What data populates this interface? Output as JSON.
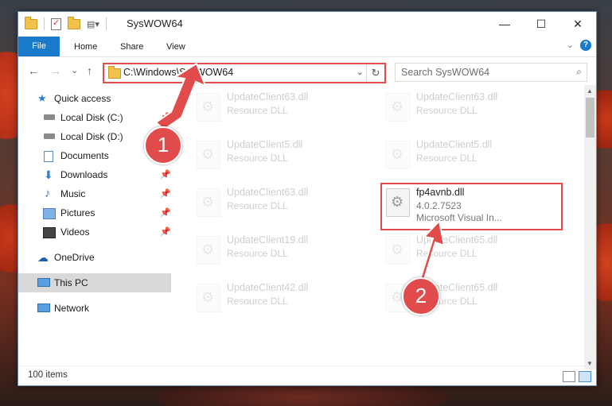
{
  "window": {
    "title": "SysWOW64",
    "minimize_glyph": "—",
    "maximize_glyph": "☐",
    "close_glyph": "✕"
  },
  "ribbon": {
    "tabs": [
      "File",
      "Home",
      "Share",
      "View"
    ],
    "help_glyph": "?",
    "expand_glyph": "⌄"
  },
  "nav": {
    "back_glyph": "←",
    "forward_glyph": "→",
    "recent_glyph": "⌄",
    "up_glyph": "↑",
    "address": "C:\\Windows\\SysWOW64",
    "address_dropdown_glyph": "⌄",
    "refresh_glyph": "↻",
    "search_placeholder": "Search SysWOW64",
    "search_glyph": "⌕"
  },
  "sidebar": {
    "items": [
      {
        "label": "Quick access",
        "icon": "star-icon"
      },
      {
        "label": "Local Disk (C:)",
        "icon": "drive-icon"
      },
      {
        "label": "Local Disk (D:)",
        "icon": "drive-icon"
      },
      {
        "label": "Documents",
        "icon": "documents-icon"
      },
      {
        "label": "Downloads",
        "icon": "download-icon"
      },
      {
        "label": "Music",
        "icon": "music-icon"
      },
      {
        "label": "Pictures",
        "icon": "pictures-icon"
      },
      {
        "label": "Videos",
        "icon": "videos-icon"
      },
      {
        "label": "OneDrive",
        "icon": "cloud-icon"
      },
      {
        "label": "This PC",
        "icon": "computer-icon"
      },
      {
        "label": "Network",
        "icon": "network-icon"
      }
    ],
    "pin_glyph": "📌"
  },
  "files": [
    {
      "name": "UpdateClient63.dll",
      "line1": "Resource DLL",
      "line2": ""
    },
    {
      "name": "UpdateClient63.dll",
      "line1": "Resource DLL",
      "line2": ""
    },
    {
      "name": "UpdateClient5.dll",
      "line1": "Resource DLL",
      "line2": ""
    },
    {
      "name": "UpdateClient5.dll",
      "line1": "Resource DLL",
      "line2": ""
    },
    {
      "name": "UpdateClient63.dll",
      "line1": "Resource DLL",
      "line2": ""
    },
    {
      "name": "fp4avnb.dll",
      "line1": "4.0.2.7523",
      "line2": "Microsoft Visual In..."
    },
    {
      "name": "UpdateClient19.dll",
      "line1": "Resource DLL",
      "line2": ""
    },
    {
      "name": "UpdateClient65.dll",
      "line1": "Resource DLL",
      "line2": ""
    },
    {
      "name": "UpdateClient42.dll",
      "line1": "Resource DLL",
      "line2": ""
    },
    {
      "name": "UpdateClient65.dll",
      "line1": "Resource DLL",
      "line2": ""
    }
  ],
  "status": {
    "item_count": "100 items"
  },
  "callouts": [
    "1",
    "2"
  ],
  "colors": {
    "accent": "#1979ca",
    "highlight": "#e24b4b",
    "selection": "#d9d9d9"
  }
}
